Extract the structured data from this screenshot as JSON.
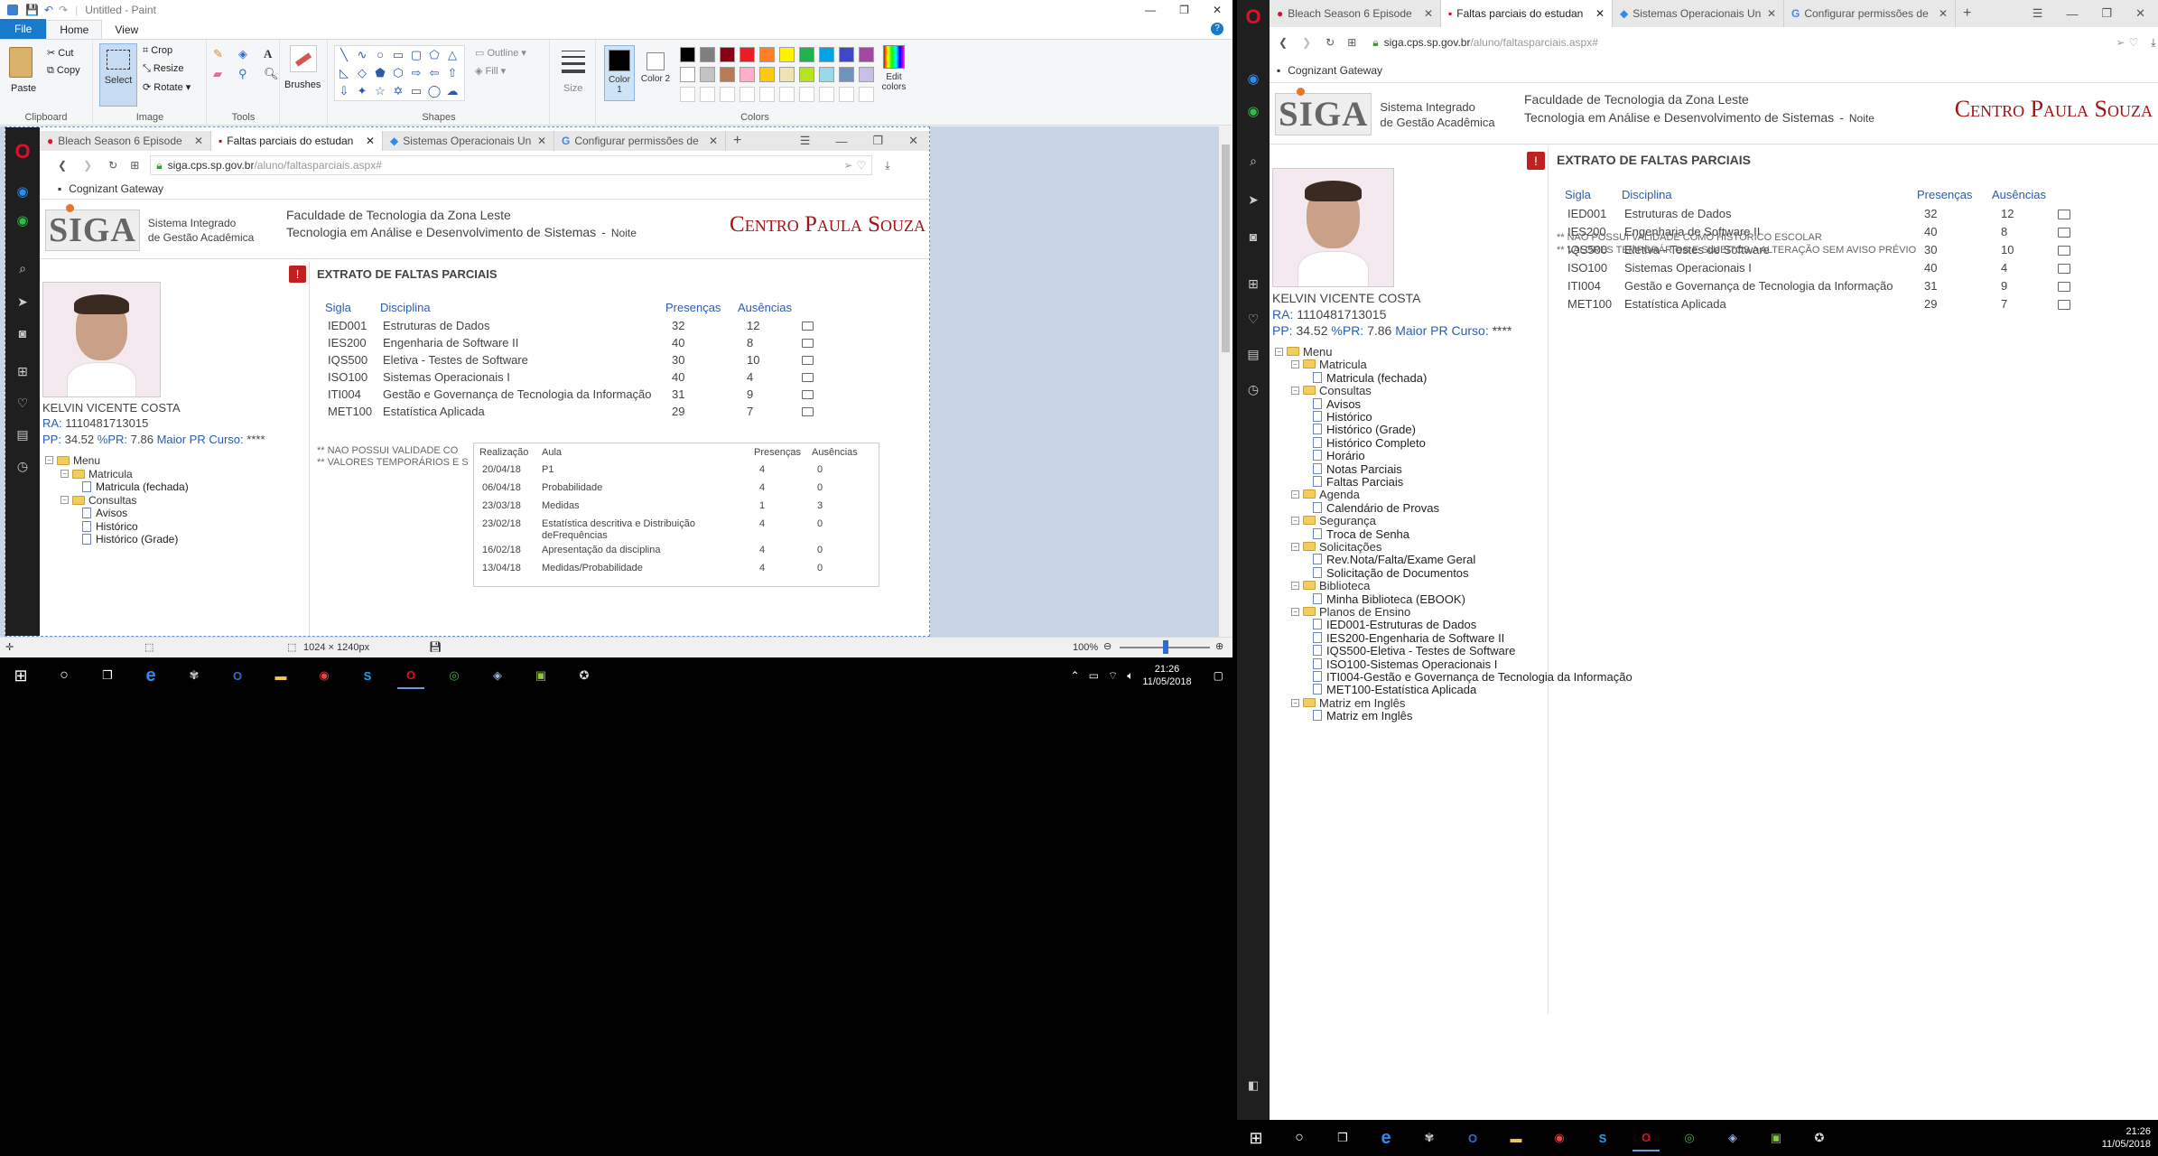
{
  "paint": {
    "title": "Untitled - Paint",
    "menu_file": "File",
    "menu_home": "Home",
    "menu_view": "View",
    "clipboard": {
      "paste": "Paste",
      "cut": "Cut",
      "copy": "Copy",
      "label": "Clipboard"
    },
    "image": {
      "select": "Select",
      "crop": "Crop",
      "resize": "Resize",
      "rotate": "Rotate",
      "label": "Image"
    },
    "tools_label": "Tools",
    "brushes": "Brushes",
    "shapes": {
      "outline": "Outline",
      "fill": "Fill",
      "label": "Shapes"
    },
    "size": "Size",
    "color1": "Color 1",
    "color2": "Color 2",
    "colors_label": "Colors",
    "edit_colors": "Edit colors",
    "palette": [
      "#000000",
      "#7f7f7f",
      "#880015",
      "#ed1c24",
      "#ff7f27",
      "#fff200",
      "#22b14c",
      "#00a2e8",
      "#3f48cc",
      "#a349a4",
      "#ffffff",
      "#c3c3c3",
      "#b97a57",
      "#ffaec9",
      "#ffc90e",
      "#efe4b0",
      "#b5e61d",
      "#99d9ea",
      "#7092be",
      "#c8bfe7"
    ],
    "status_size": "1024 × 1240px",
    "zoom": "100%"
  },
  "browser": {
    "tabs": [
      {
        "label": "Bleach Season 6 Episode"
      },
      {
        "label": "Faltas parciais do estudan"
      },
      {
        "label": "Sistemas Operacionais Un"
      },
      {
        "label": "Configurar permissões de"
      }
    ],
    "url_host": "siga.cps.sp.gov.br",
    "url_path": "/aluno/faltasparciais.aspx#",
    "bookmark": "Cognizant Gateway"
  },
  "siga": {
    "logo": "SIGA",
    "logo_sub1": "Sistema Integrado",
    "logo_sub2": "de Gestão Acadêmica",
    "faculty": "Faculdade de Tecnologia da Zona Leste",
    "course": "Tecnologia em Análise e Desenvolvimento de Sistemas",
    "sep": "-",
    "period": "Noite",
    "cps": "Centro Paula Souza",
    "page_title": "EXTRATO DE FALTAS PARCIAIS",
    "student_name": "KELVIN VICENTE COSTA",
    "ra_label": "RA:",
    "ra": "1110481713015",
    "pp_label": "PP:",
    "pp": "34.52",
    "pr_label": "%PR:",
    "pr": "7.86",
    "maior_pr": "Maior PR Curso:",
    "maior_pr_val": "****",
    "headers": {
      "sigla": "Sigla",
      "disciplina": "Disciplina",
      "presencas": "Presenças",
      "ausencias": "Ausências"
    },
    "rows": [
      {
        "sigla": "IED001",
        "disciplina": "Estruturas de Dados",
        "presencas": "32",
        "ausencias": "12"
      },
      {
        "sigla": "IES200",
        "disciplina": "Engenharia de Software II",
        "presencas": "40",
        "ausencias": "8"
      },
      {
        "sigla": "IQS500",
        "disciplina": "Eletiva - Testes de Software",
        "presencas": "30",
        "ausencias": "10"
      },
      {
        "sigla": "ISO100",
        "disciplina": "Sistemas Operacionais I",
        "presencas": "40",
        "ausencias": "4"
      },
      {
        "sigla": "ITI004",
        "disciplina": "Gestão e Governança de Tecnologia da Informação",
        "presencas": "31",
        "ausencias": "9"
      },
      {
        "sigla": "MET100",
        "disciplina": "Estatística Aplicada",
        "presencas": "29",
        "ausencias": "7"
      }
    ],
    "note1": "** NAO POSSUI VALIDADE COMO HISTÓRICO ESCOLAR",
    "note2": "** VALORES TEMPORÁRIOS E SUJEITOS A ALTERAÇÃO SEM AVISO PRÉVIO",
    "note1_cut": "** NAO POSSUI VALIDADE CO",
    "note2_cut": "** VALORES TEMPORÁRIOS E S",
    "popup": {
      "headers": {
        "realizacao": "Realização",
        "aula": "Aula",
        "presencas": "Presenças",
        "ausencias": "Ausências"
      },
      "rows": [
        {
          "data": "20/04/18",
          "aula": "P1",
          "p": "4",
          "a": "0"
        },
        {
          "data": "06/04/18",
          "aula": "Probabilidade",
          "p": "4",
          "a": "0"
        },
        {
          "data": "23/03/18",
          "aula": "Medidas",
          "p": "1",
          "a": "3"
        },
        {
          "data": "23/02/18",
          "aula": "Estatística descritiva e Distribuição deFrequências",
          "p": "4",
          "a": "0"
        },
        {
          "data": "16/02/18",
          "aula": "Apresentação da disciplina",
          "p": "4",
          "a": "0"
        },
        {
          "data": "13/04/18",
          "aula": "Medidas/Probabilidade",
          "p": "4",
          "a": "0"
        }
      ]
    },
    "menu": [
      {
        "type": "folder",
        "label": "Menu",
        "level": 0
      },
      {
        "type": "folder",
        "label": "Matricula",
        "level": 1
      },
      {
        "type": "page",
        "label": "Matricula (fechada)",
        "level": 2
      },
      {
        "type": "folder",
        "label": "Consultas",
        "level": 1
      },
      {
        "type": "page",
        "label": "Avisos",
        "level": 2
      },
      {
        "type": "page",
        "label": "Histórico",
        "level": 2
      },
      {
        "type": "page",
        "label": "Histórico (Grade)",
        "level": 2
      },
      {
        "type": "page",
        "label": "Histórico Completo",
        "level": 2
      },
      {
        "type": "page",
        "label": "Horário",
        "level": 2
      },
      {
        "type": "page",
        "label": "Notas Parciais",
        "level": 2
      },
      {
        "type": "page",
        "label": "Faltas Parciais",
        "level": 2
      },
      {
        "type": "folder",
        "label": "Agenda",
        "level": 1
      },
      {
        "type": "page",
        "label": "Calendário de Provas",
        "level": 2
      },
      {
        "type": "folder",
        "label": "Segurança",
        "level": 1
      },
      {
        "type": "page",
        "label": "Troca de Senha",
        "level": 2
      },
      {
        "type": "folder",
        "label": "Solicitações",
        "level": 1
      },
      {
        "type": "page",
        "label": "Rev.Nota/Falta/Exame Geral",
        "level": 2
      },
      {
        "type": "page",
        "label": "Solicitação de Documentos",
        "level": 2
      },
      {
        "type": "folder",
        "label": "Biblioteca",
        "level": 1
      },
      {
        "type": "page",
        "label": "Minha Biblioteca (EBOOK)",
        "level": 2
      },
      {
        "type": "folder",
        "label": "Planos de Ensino",
        "level": 1
      },
      {
        "type": "page",
        "label": "IED001-Estruturas de Dados",
        "level": 2
      },
      {
        "type": "page",
        "label": "IES200-Engenharia de Software II",
        "level": 2
      },
      {
        "type": "page",
        "label": "IQS500-Eletiva - Testes de Software",
        "level": 2
      },
      {
        "type": "page",
        "label": "ISO100-Sistemas Operacionais I",
        "level": 2
      },
      {
        "type": "page",
        "label": "ITI004-Gestão e Governança de Tecnologia da Informação",
        "level": 2
      },
      {
        "type": "page",
        "label": "MET100-Estatística Aplicada",
        "level": 2
      },
      {
        "type": "folder",
        "label": "Matriz em Inglês",
        "level": 1
      },
      {
        "type": "page",
        "label": "Matriz em Inglês",
        "level": 2
      }
    ]
  },
  "taskbar": {
    "time": "21:26",
    "date": "11/05/2018"
  }
}
